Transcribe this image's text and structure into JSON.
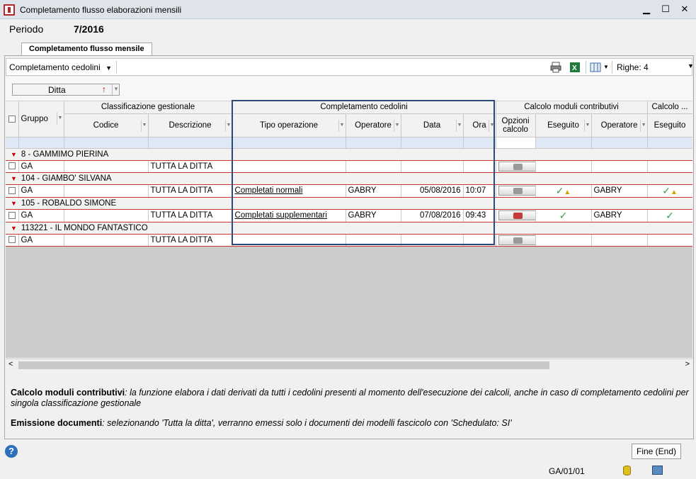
{
  "window": {
    "title": "Completamento flusso elaborazioni mensili",
    "minimize": "▁",
    "maximize": "☐",
    "close": "✕"
  },
  "periodo": {
    "label": "Periodo",
    "value": "7/2016"
  },
  "tab": {
    "label": "Completamento flusso mensile"
  },
  "toolbar": {
    "view_label": "Completamento cedolini",
    "righe_label": "Righe: 4"
  },
  "grouping": {
    "chip_label": "Ditta"
  },
  "grid": {
    "group_headers": {
      "classificazione": "Classificazione gestionale",
      "completamento": "Completamento cedolini",
      "calcolo_moduli": "Calcolo moduli contributivi",
      "calcolo_other": "Calcolo ..."
    },
    "columns": {
      "gruppo": "Gruppo",
      "codice": "Codice",
      "descrizione": "Descrizione",
      "tipo_operazione": "Tipo operazione",
      "operatore": "Operatore",
      "data": "Data",
      "ora": "Ora",
      "opzioni_calcolo": "Opzioni calcolo",
      "eseguito": "Eseguito",
      "operatore2": "Operatore",
      "eseguito2": "Eseguito"
    },
    "groups": [
      {
        "title": "8 - GAMMIMO PIERINA",
        "row": {
          "gruppo": "GA",
          "codice": "",
          "descrizione": "TUTTA LA DITTA",
          "tipo": "",
          "operatore": "",
          "data": "",
          "ora": "",
          "operatore2": ""
        }
      },
      {
        "title": "104 - GIAMBO' SILVANA",
        "row": {
          "gruppo": "GA",
          "codice": "",
          "descrizione": "TUTTA LA DITTA",
          "tipo": "Completati normali",
          "operatore": "GABRY",
          "data": "05/08/2016",
          "ora": "10:07",
          "operatore2": "GABRY"
        }
      },
      {
        "title": "105 - ROBALDO SIMONE",
        "row": {
          "gruppo": "GA",
          "codice": "",
          "descrizione": "TUTTA LA DITTA",
          "tipo": "Completati supplementari",
          "operatore": "GABRY",
          "data": "07/08/2016",
          "ora": "09:43",
          "operatore2": "GABRY"
        }
      },
      {
        "title": "113221 - IL MONDO FANTASTICO",
        "row": {
          "gruppo": "GA",
          "codice": "",
          "descrizione": "TUTTA LA DITTA",
          "tipo": "",
          "operatore": "",
          "data": "",
          "ora": "",
          "operatore2": ""
        }
      }
    ]
  },
  "notes": {
    "n1_bold": "Calcolo moduli contributivi",
    "n1_text": ": la funzione elabora i dati derivati da tutti i cedolini presenti al momento dell'esecuzione dei calcoli, anche in caso di completamento cedolini per singola classificazione gestionale",
    "n2_bold": "Emissione documenti",
    "n2_text": ": selezionando 'Tutta la ditta', verranno emessi solo i documenti dei modelli fascicolo con 'Schedulato: SI'"
  },
  "footer": {
    "help": "?",
    "fine_button": "Fine (End)",
    "status_code": "GA/01/01"
  },
  "icons": [
    "app-icon",
    "print-icon",
    "excel-icon",
    "columns-config-icon",
    "sort-up-icon",
    "calculator-icon",
    "check-icon",
    "warning-icon",
    "help-icon",
    "database-icon",
    "network-icon"
  ]
}
